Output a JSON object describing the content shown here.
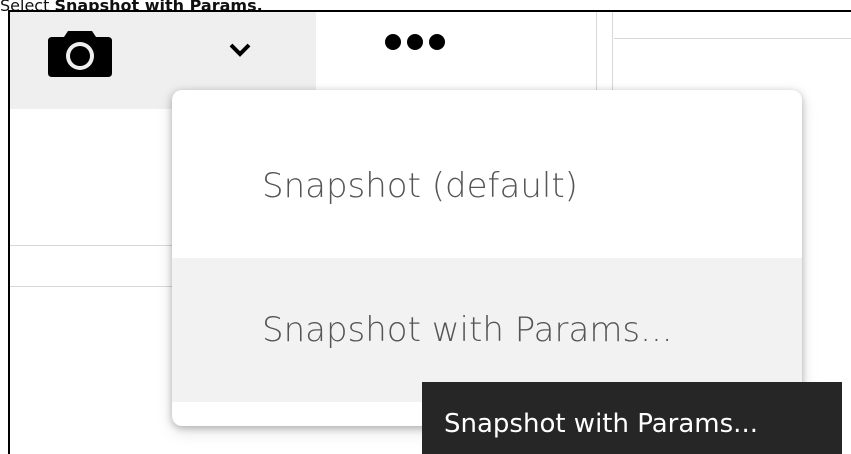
{
  "caption": {
    "prefix": "Select ",
    "bold": "Snapshot with Params."
  },
  "toolbar": {
    "camera_icon": "camera-icon",
    "chevron_icon": "chevron-down-icon",
    "more_icon": "more-horizontal-icon"
  },
  "menu": {
    "items": [
      {
        "label": "Snapshot (default)"
      },
      {
        "label": "Snapshot with Params..."
      }
    ]
  },
  "tooltip": {
    "text": "Snapshot with Params..."
  },
  "colors": {
    "toolbar_bg": "#efefef",
    "hover_bg": "#f2f2f2",
    "tooltip_bg": "#262626",
    "menu_text": "#555555"
  }
}
